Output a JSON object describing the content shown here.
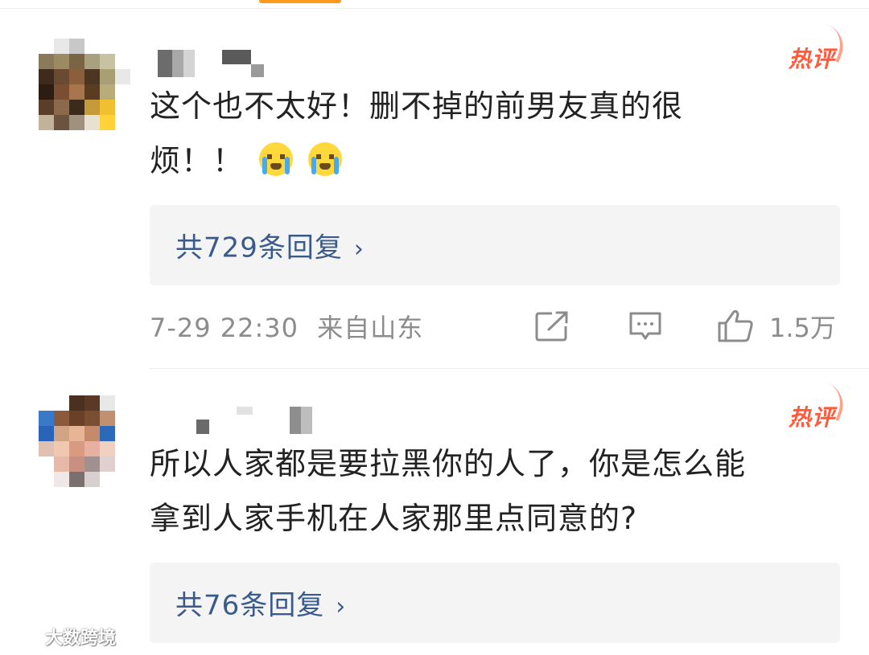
{
  "comments": [
    {
      "hot_badge": "热评",
      "text_line1": "这个也不太好！删不掉的前男友真的很",
      "text_line2": "烦！！",
      "emoji_1": "crying-emoji",
      "emoji_2": "crying-emoji",
      "replies_label": "共729条回复",
      "timestamp": "7-29 22:30",
      "location": "来自山东",
      "like_count": "1.5万"
    },
    {
      "hot_badge": "热评",
      "text_line1": "所以人家都是要拉黑你的人了，你是怎么能",
      "text_line2": "拿到人家手机在人家那里点同意的?",
      "replies_label": "共76条回复"
    }
  ],
  "icons": {
    "share": "share-icon",
    "comment": "comment-icon",
    "like": "thumbs-up-icon",
    "chevron": "chevron-right-icon"
  },
  "colors": {
    "hot_badge": "#ff5a3c",
    "link": "#3a5a8c",
    "meta": "#8c8c8c",
    "reply_box_bg": "#f4f4f4",
    "tab_accent": "#ff9a1e"
  },
  "watermark": {
    "text": "大数跨境"
  }
}
